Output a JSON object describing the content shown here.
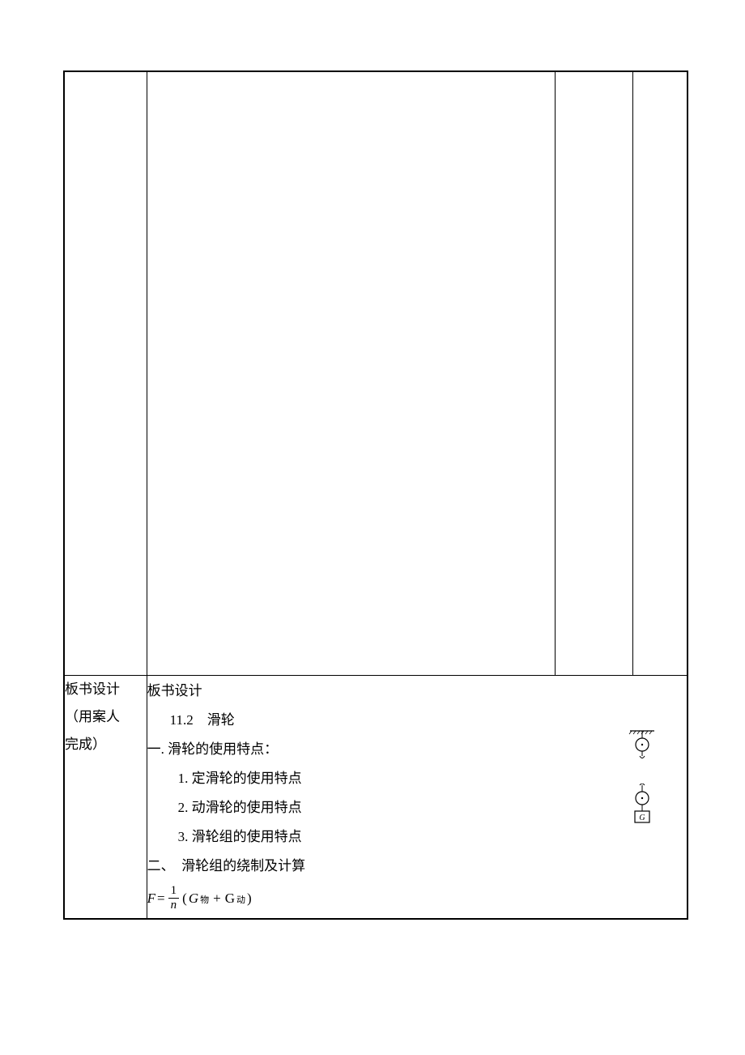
{
  "left_label": {
    "line1": "板书设计",
    "line2": "（用案人",
    "line3": "完成）"
  },
  "blackboard": {
    "heading": "板书设计",
    "chapter": "11.2　滑轮",
    "section1": "一. 滑轮的使用特点：",
    "item1": "1. 定滑轮的使用特点",
    "item2": "2. 动滑轮的使用特点",
    "item3": "3. 滑轮组的使用特点",
    "section2": "二、　滑轮组的绕制及计算",
    "formula": {
      "F": "F",
      "eq": "=",
      "num": "1",
      "den": "n",
      "lparen": "(",
      "G1": "G",
      "sub1": "物",
      "plus": "+",
      "G2": "G",
      "sub2": "动",
      "rparen": ")"
    }
  },
  "diagram": {
    "movable_block_label": "G"
  }
}
